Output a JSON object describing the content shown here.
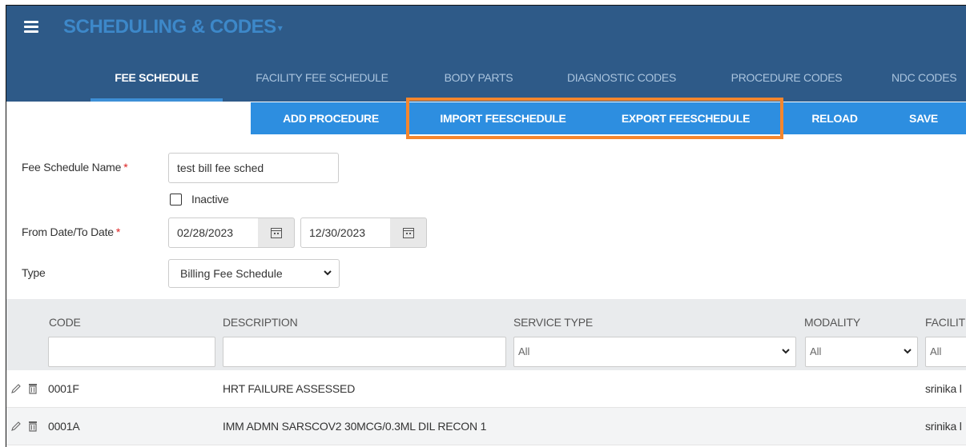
{
  "app": {
    "title": "SCHEDULING & CODES"
  },
  "tabs": [
    {
      "label": "FEE SCHEDULE",
      "active": true
    },
    {
      "label": "FACILITY FEE SCHEDULE"
    },
    {
      "label": "BODY PARTS"
    },
    {
      "label": "DIAGNOSTIC CODES"
    },
    {
      "label": "PROCEDURE CODES"
    },
    {
      "label": "NDC CODES"
    }
  ],
  "toolbar": {
    "add_procedure": "ADD PROCEDURE",
    "import_feeschedule": "IMPORT FEESCHEDULE",
    "export_feeschedule": "EXPORT FEESCHEDULE",
    "reload": "RELOAD",
    "save": "SAVE"
  },
  "form": {
    "fee_schedule_name_label": "Fee Schedule Name",
    "required_mark": "*",
    "fee_schedule_name_value": "test bill fee sched",
    "inactive_label": "Inactive",
    "inactive_checked": false,
    "date_label": "From Date/To Date",
    "from_date": "02/28/2023",
    "to_date": "12/30/2023",
    "type_label": "Type",
    "type_value": "Billing Fee Schedule"
  },
  "grid": {
    "columns": [
      "CODE",
      "DESCRIPTION",
      "SERVICE TYPE",
      "MODALITY",
      "FACILIT"
    ],
    "filters": {
      "service_type": "All",
      "modality": "All",
      "facility": "All"
    },
    "rows": [
      {
        "code": "0001F",
        "description": "HRT FAILURE ASSESSED",
        "facility": "srinika l"
      },
      {
        "code": "0001A",
        "description": "IMM ADMN SARSCOV2 30MCG/0.3ML DIL RECON 1",
        "facility": "srinika l"
      }
    ]
  },
  "colors": {
    "header_bg": "#2e5a88",
    "title": "#3d88c9",
    "toolbar_bg": "#2d8ee0",
    "active_tab_underline": "#3d8fd6",
    "highlight": "#f5862d",
    "required": "#d22222"
  },
  "icons": [
    "hamburger-menu-icon",
    "calendar-icon",
    "chevron-down-icon",
    "pencil-icon",
    "trash-icon"
  ]
}
